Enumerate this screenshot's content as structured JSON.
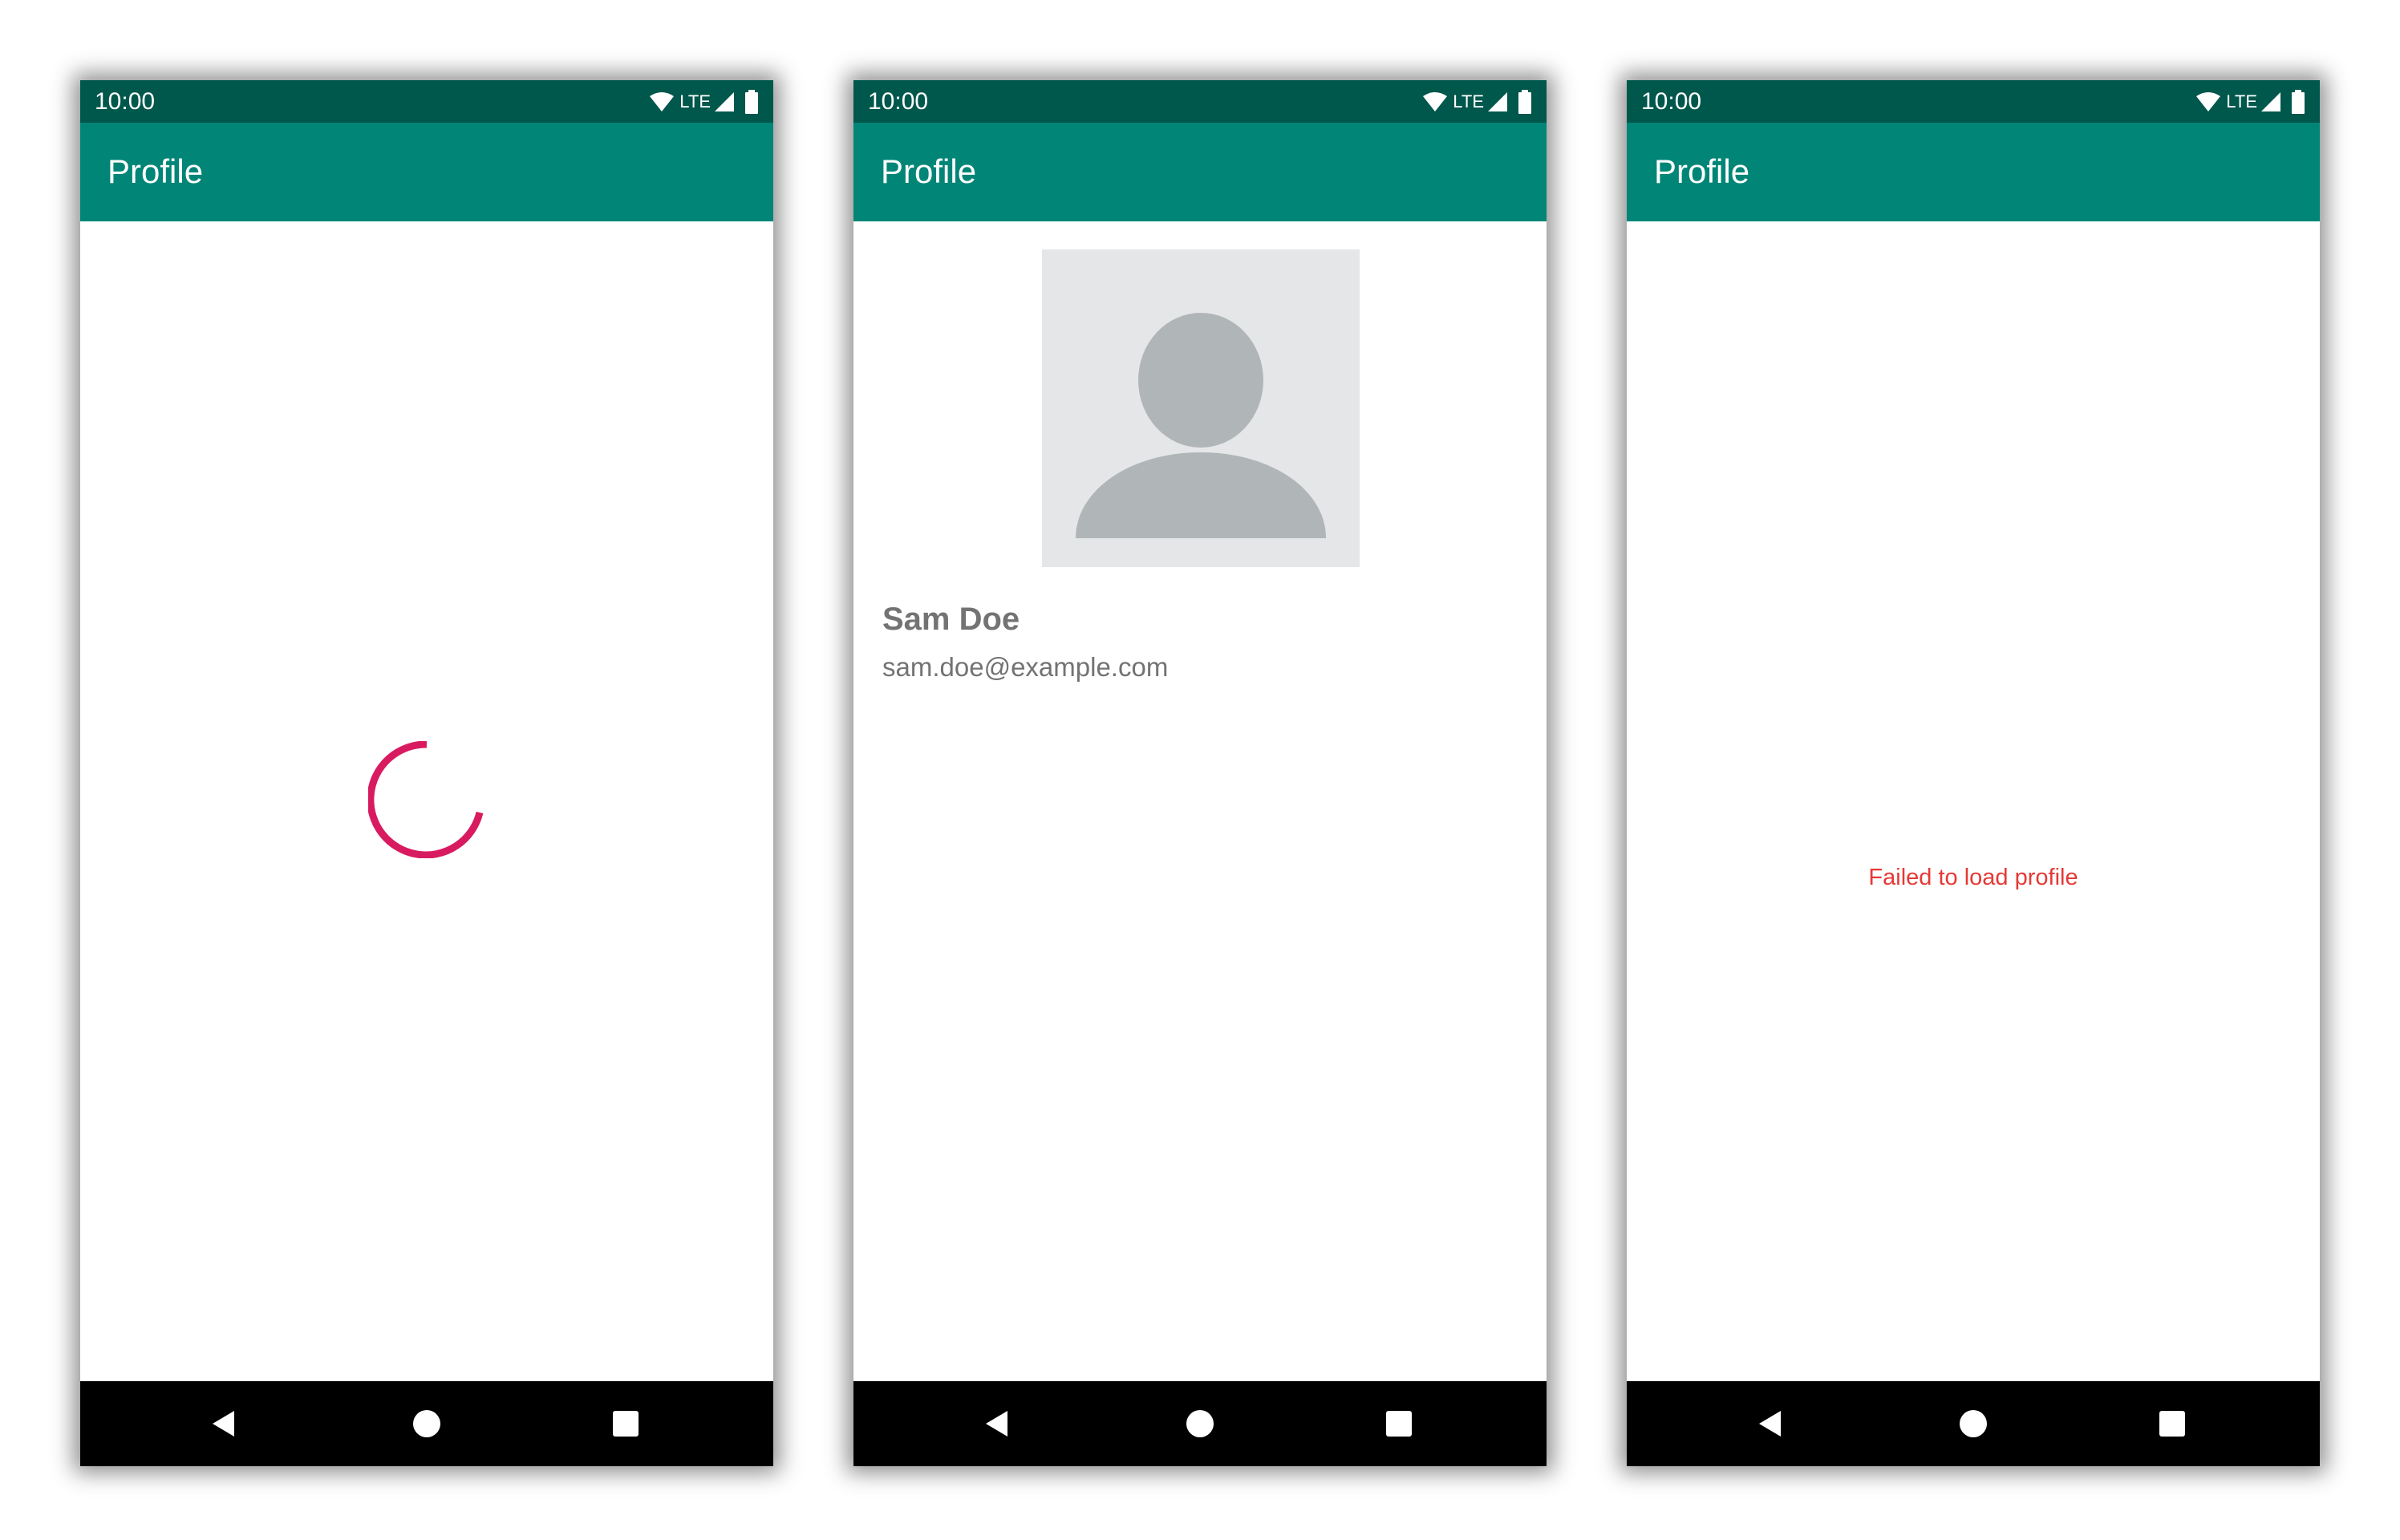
{
  "colors": {
    "status_bar": "#00574b",
    "app_bar": "#008577",
    "spinner": "#d81b60",
    "error": "#e53935",
    "secondary_text": "#737373",
    "avatar_background": "#e5e6e7",
    "avatar_silhouette": "#b0b5b8"
  },
  "screens": [
    {
      "state": "loading",
      "status_bar": {
        "time": "10:00",
        "network": "LTE"
      },
      "app_bar": {
        "title": "Profile"
      },
      "content": {
        "indicator": "progress-spinner-icon"
      },
      "nav": {
        "icons": [
          "back-icon",
          "home-icon",
          "recents-icon"
        ]
      }
    },
    {
      "state": "loaded",
      "status_bar": {
        "time": "10:00",
        "network": "LTE"
      },
      "app_bar": {
        "title": "Profile"
      },
      "content": {
        "avatar_icon": "person-placeholder-icon",
        "name": "Sam Doe",
        "email": "sam.doe@example.com"
      },
      "nav": {
        "icons": [
          "back-icon",
          "home-icon",
          "recents-icon"
        ]
      }
    },
    {
      "state": "error",
      "status_bar": {
        "time": "10:00",
        "network": "LTE"
      },
      "app_bar": {
        "title": "Profile"
      },
      "content": {
        "message": "Failed to load profile"
      },
      "nav": {
        "icons": [
          "back-icon",
          "home-icon",
          "recents-icon"
        ]
      }
    }
  ]
}
